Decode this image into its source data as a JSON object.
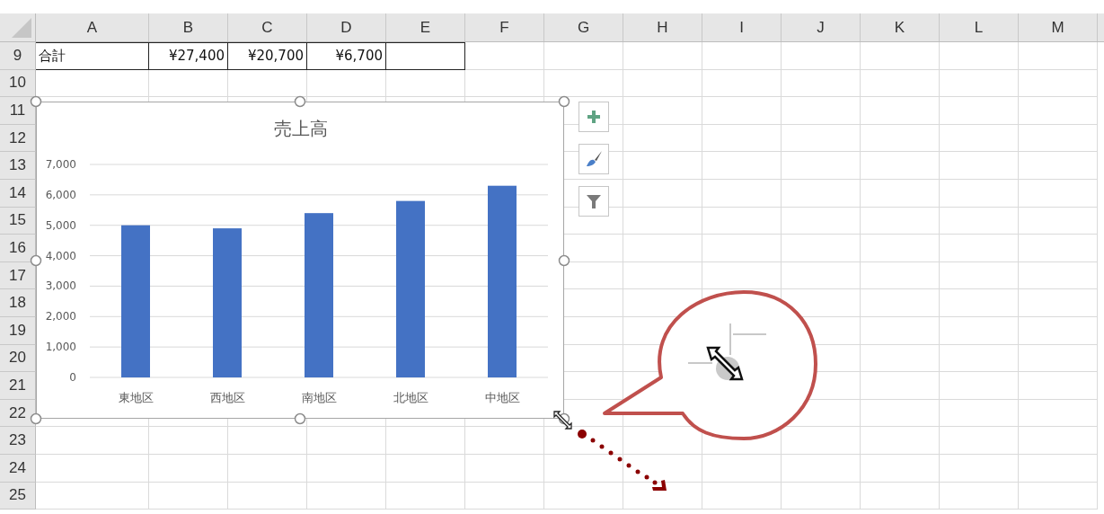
{
  "columns": [
    "A",
    "B",
    "C",
    "D",
    "E",
    "F",
    "G",
    "H",
    "I",
    "J",
    "K",
    "L",
    "M"
  ],
  "rows": [
    {
      "number": "9",
      "bordered": true,
      "cells": [
        "合計",
        "¥27,400",
        "¥20,700",
        "¥6,700"
      ]
    },
    {
      "number": "10"
    },
    {
      "number": "11"
    },
    {
      "number": "12"
    },
    {
      "number": "13"
    },
    {
      "number": "14"
    },
    {
      "number": "15"
    },
    {
      "number": "16"
    },
    {
      "number": "17"
    },
    {
      "number": "18"
    },
    {
      "number": "19"
    },
    {
      "number": "20"
    },
    {
      "number": "21"
    },
    {
      "number": "22"
    },
    {
      "number": "23"
    },
    {
      "number": "24"
    },
    {
      "number": "25"
    }
  ],
  "chart": {
    "selected": true,
    "chart_data": {
      "type": "bar",
      "title": "売上高",
      "categories": [
        "東地区",
        "西地区",
        "南地区",
        "北地区",
        "中地区"
      ],
      "values": [
        5000,
        4900,
        5400,
        5800,
        6300
      ],
      "grid": true,
      "ylim": [
        0,
        7000
      ],
      "yticks": [
        {
          "value": 0,
          "label": "0"
        },
        {
          "value": 1000,
          "label": "1,000"
        },
        {
          "value": 2000,
          "label": "2,000"
        },
        {
          "value": 3000,
          "label": "3,000"
        },
        {
          "value": 4000,
          "label": "4,000"
        },
        {
          "value": 5000,
          "label": "5,000"
        },
        {
          "value": 6000,
          "label": "6,000"
        },
        {
          "value": 7000,
          "label": "7,000"
        }
      ]
    }
  }
}
